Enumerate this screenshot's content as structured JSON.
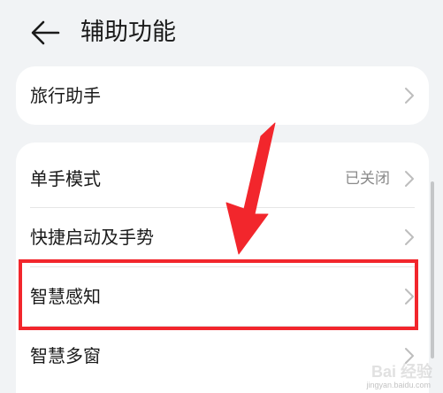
{
  "header": {
    "title": "辅助功能",
    "back_icon": "arrow-left-icon"
  },
  "card_top": {
    "items": [
      {
        "label": "旅行助手",
        "value": ""
      }
    ]
  },
  "card_main": {
    "items": [
      {
        "label": "单手模式",
        "value": "已关闭"
      },
      {
        "label": "快捷启动及手势",
        "value": ""
      },
      {
        "label": "智慧感知",
        "value": ""
      },
      {
        "label": "智慧多窗",
        "value": ""
      }
    ]
  },
  "annotation": {
    "highlight_color": "#f2262c",
    "arrow_color": "#f2262c"
  },
  "watermark": {
    "text": "Bai 经验",
    "subtext": "jingyan.baidu.com"
  },
  "colors": {
    "background": "#f1f3f5",
    "card": "#ffffff",
    "secondary_text": "#8a8a8a"
  }
}
